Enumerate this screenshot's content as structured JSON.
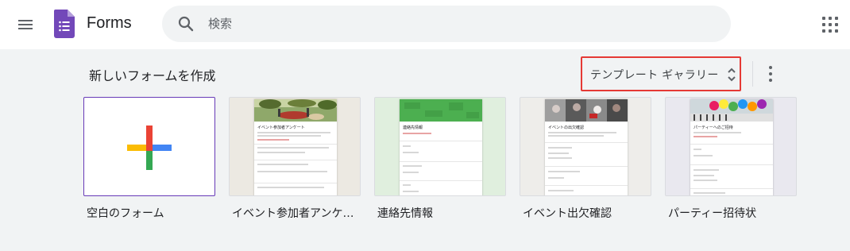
{
  "header": {
    "app_title": "Forms",
    "search_placeholder": "検索"
  },
  "main": {
    "section_title": "新しいフォームを作成",
    "gallery_label": "テンプレート ギャラリー"
  },
  "templates": [
    {
      "label": "空白のフォーム"
    },
    {
      "label": "イベント参加者アンケ…",
      "preview_title": "イベント参加者アンケート",
      "bg": "#ece9e2"
    },
    {
      "label": "連絡先情報",
      "preview_title": "連絡先情報",
      "bg": "#e0efde"
    },
    {
      "label": "イベント出欠確認",
      "preview_title": "イベントの出欠確認",
      "bg": "#eeedea"
    },
    {
      "label": "パーティー招待状",
      "preview_title": "パーティーへのご招待",
      "bg": "#e9e8ef"
    }
  ],
  "colors": {
    "forms_purple": "#673ab7",
    "highlight_red": "#e53935",
    "plus_red": "#ea4335",
    "plus_blue": "#4285f4",
    "plus_green": "#34a853",
    "plus_yellow": "#fbbc04"
  },
  "icons": [
    "hamburger-menu-icon",
    "forms-logo-icon",
    "search-icon",
    "unfold-icon",
    "more-vert-icon",
    "apps-grid-icon",
    "plus-icon"
  ]
}
